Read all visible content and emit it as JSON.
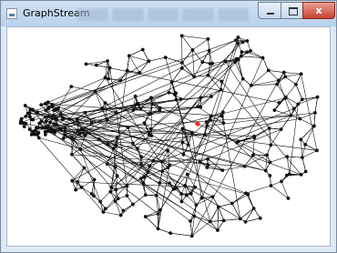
{
  "window": {
    "title": "GraphStream",
    "controls": {
      "minimize": "minimize-button",
      "maximize": "maximize-button",
      "close": "close-button",
      "close_glyph": "x"
    }
  },
  "graph": {
    "node_color": "#111111",
    "highlight_node_color": "#e03030",
    "edge_color": "#000000"
  }
}
